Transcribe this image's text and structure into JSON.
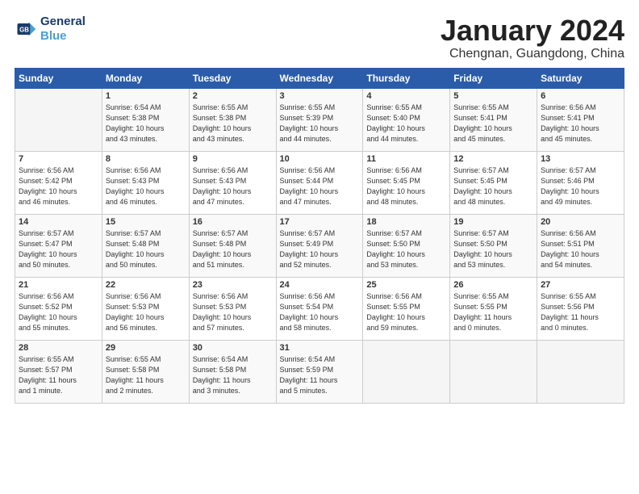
{
  "logo": {
    "line1": "General",
    "line2": "Blue"
  },
  "title": "January 2024",
  "subtitle": "Chengnan, Guangdong, China",
  "days_header": [
    "Sunday",
    "Monday",
    "Tuesday",
    "Wednesday",
    "Thursday",
    "Friday",
    "Saturday"
  ],
  "weeks": [
    [
      {
        "day": "",
        "info": ""
      },
      {
        "day": "1",
        "info": "Sunrise: 6:54 AM\nSunset: 5:38 PM\nDaylight: 10 hours\nand 43 minutes."
      },
      {
        "day": "2",
        "info": "Sunrise: 6:55 AM\nSunset: 5:38 PM\nDaylight: 10 hours\nand 43 minutes."
      },
      {
        "day": "3",
        "info": "Sunrise: 6:55 AM\nSunset: 5:39 PM\nDaylight: 10 hours\nand 44 minutes."
      },
      {
        "day": "4",
        "info": "Sunrise: 6:55 AM\nSunset: 5:40 PM\nDaylight: 10 hours\nand 44 minutes."
      },
      {
        "day": "5",
        "info": "Sunrise: 6:55 AM\nSunset: 5:41 PM\nDaylight: 10 hours\nand 45 minutes."
      },
      {
        "day": "6",
        "info": "Sunrise: 6:56 AM\nSunset: 5:41 PM\nDaylight: 10 hours\nand 45 minutes."
      }
    ],
    [
      {
        "day": "7",
        "info": "Sunrise: 6:56 AM\nSunset: 5:42 PM\nDaylight: 10 hours\nand 46 minutes."
      },
      {
        "day": "8",
        "info": "Sunrise: 6:56 AM\nSunset: 5:43 PM\nDaylight: 10 hours\nand 46 minutes."
      },
      {
        "day": "9",
        "info": "Sunrise: 6:56 AM\nSunset: 5:43 PM\nDaylight: 10 hours\nand 47 minutes."
      },
      {
        "day": "10",
        "info": "Sunrise: 6:56 AM\nSunset: 5:44 PM\nDaylight: 10 hours\nand 47 minutes."
      },
      {
        "day": "11",
        "info": "Sunrise: 6:56 AM\nSunset: 5:45 PM\nDaylight: 10 hours\nand 48 minutes."
      },
      {
        "day": "12",
        "info": "Sunrise: 6:57 AM\nSunset: 5:45 PM\nDaylight: 10 hours\nand 48 minutes."
      },
      {
        "day": "13",
        "info": "Sunrise: 6:57 AM\nSunset: 5:46 PM\nDaylight: 10 hours\nand 49 minutes."
      }
    ],
    [
      {
        "day": "14",
        "info": "Sunrise: 6:57 AM\nSunset: 5:47 PM\nDaylight: 10 hours\nand 50 minutes."
      },
      {
        "day": "15",
        "info": "Sunrise: 6:57 AM\nSunset: 5:48 PM\nDaylight: 10 hours\nand 50 minutes."
      },
      {
        "day": "16",
        "info": "Sunrise: 6:57 AM\nSunset: 5:48 PM\nDaylight: 10 hours\nand 51 minutes."
      },
      {
        "day": "17",
        "info": "Sunrise: 6:57 AM\nSunset: 5:49 PM\nDaylight: 10 hours\nand 52 minutes."
      },
      {
        "day": "18",
        "info": "Sunrise: 6:57 AM\nSunset: 5:50 PM\nDaylight: 10 hours\nand 53 minutes."
      },
      {
        "day": "19",
        "info": "Sunrise: 6:57 AM\nSunset: 5:50 PM\nDaylight: 10 hours\nand 53 minutes."
      },
      {
        "day": "20",
        "info": "Sunrise: 6:56 AM\nSunset: 5:51 PM\nDaylight: 10 hours\nand 54 minutes."
      }
    ],
    [
      {
        "day": "21",
        "info": "Sunrise: 6:56 AM\nSunset: 5:52 PM\nDaylight: 10 hours\nand 55 minutes."
      },
      {
        "day": "22",
        "info": "Sunrise: 6:56 AM\nSunset: 5:53 PM\nDaylight: 10 hours\nand 56 minutes."
      },
      {
        "day": "23",
        "info": "Sunrise: 6:56 AM\nSunset: 5:53 PM\nDaylight: 10 hours\nand 57 minutes."
      },
      {
        "day": "24",
        "info": "Sunrise: 6:56 AM\nSunset: 5:54 PM\nDaylight: 10 hours\nand 58 minutes."
      },
      {
        "day": "25",
        "info": "Sunrise: 6:56 AM\nSunset: 5:55 PM\nDaylight: 10 hours\nand 59 minutes."
      },
      {
        "day": "26",
        "info": "Sunrise: 6:55 AM\nSunset: 5:55 PM\nDaylight: 11 hours\nand 0 minutes."
      },
      {
        "day": "27",
        "info": "Sunrise: 6:55 AM\nSunset: 5:56 PM\nDaylight: 11 hours\nand 0 minutes."
      }
    ],
    [
      {
        "day": "28",
        "info": "Sunrise: 6:55 AM\nSunset: 5:57 PM\nDaylight: 11 hours\nand 1 minute."
      },
      {
        "day": "29",
        "info": "Sunrise: 6:55 AM\nSunset: 5:58 PM\nDaylight: 11 hours\nand 2 minutes."
      },
      {
        "day": "30",
        "info": "Sunrise: 6:54 AM\nSunset: 5:58 PM\nDaylight: 11 hours\nand 3 minutes."
      },
      {
        "day": "31",
        "info": "Sunrise: 6:54 AM\nSunset: 5:59 PM\nDaylight: 11 hours\nand 5 minutes."
      },
      {
        "day": "",
        "info": ""
      },
      {
        "day": "",
        "info": ""
      },
      {
        "day": "",
        "info": ""
      }
    ]
  ]
}
